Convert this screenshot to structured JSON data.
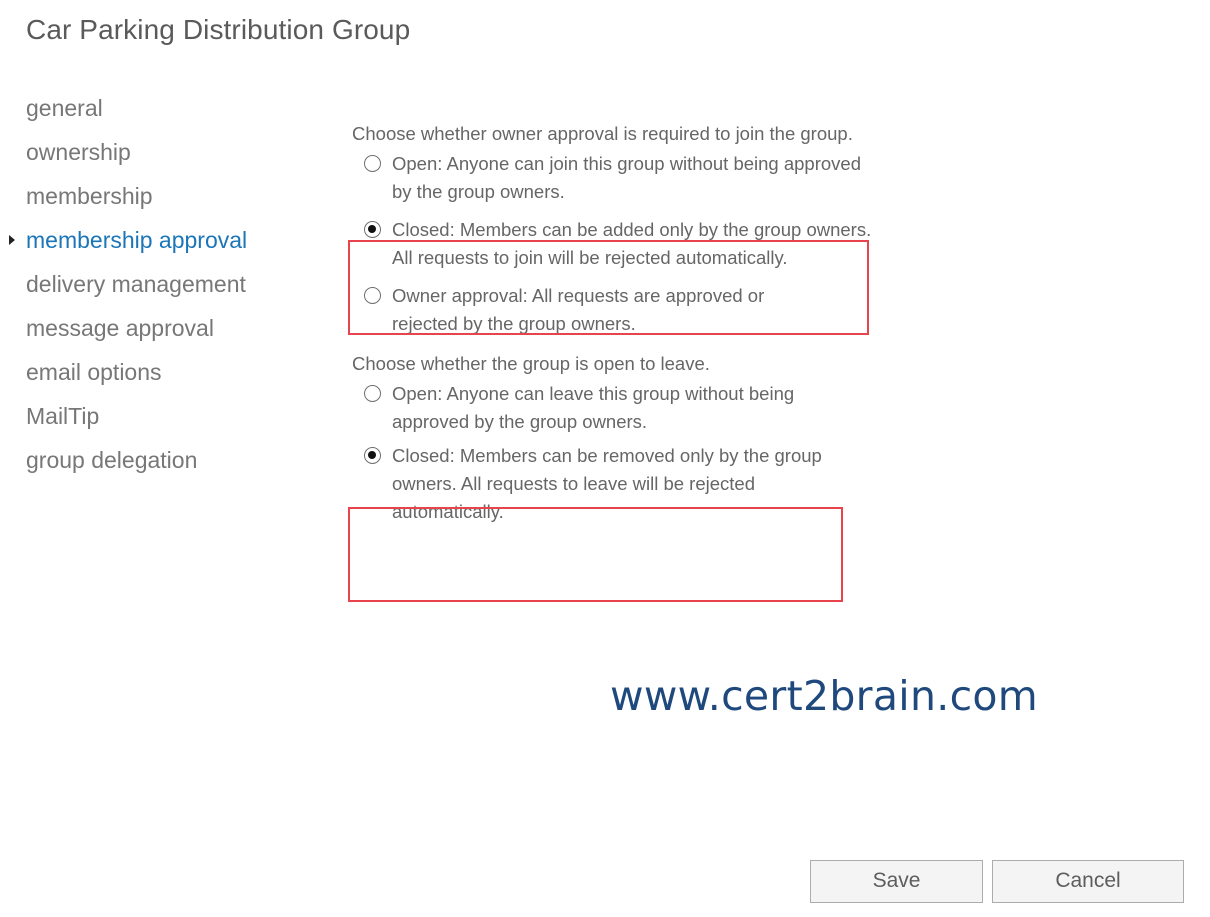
{
  "window": {
    "title": "Car Parking Distribution Group"
  },
  "sidebar": {
    "items": [
      {
        "label": "general",
        "active": false
      },
      {
        "label": "ownership",
        "active": false
      },
      {
        "label": "membership",
        "active": false
      },
      {
        "label": "membership approval",
        "active": true
      },
      {
        "label": "delivery management",
        "active": false
      },
      {
        "label": "message approval",
        "active": false
      },
      {
        "label": "email options",
        "active": false
      },
      {
        "label": "MailTip",
        "active": false
      },
      {
        "label": "group delegation",
        "active": false
      }
    ],
    "active_color": "#1b76b8"
  },
  "join": {
    "prompt": "Choose whether owner approval is required to join the group.",
    "options": [
      {
        "label": "Open: Anyone can join this group without being approved by the group owners.",
        "checked": false
      },
      {
        "label": "Closed: Members can be added only by the group owners. All requests to join will be rejected automatically.",
        "checked": true
      },
      {
        "label": "Owner approval: All requests are approved or rejected by the group owners.",
        "checked": false
      }
    ]
  },
  "leave": {
    "prompt": "Choose whether the group is open to leave.",
    "options": [
      {
        "label": "Open: Anyone can leave this group without being approved by the group owners.",
        "checked": false
      },
      {
        "label": "Closed: Members can be removed only by the group owners. All requests to leave will be rejected automatically.",
        "checked": true
      }
    ]
  },
  "highlight_color": "#e8444d",
  "watermark": {
    "text": "www.cert2brain.com",
    "color": "#1f497d"
  },
  "footer": {
    "save_label": "Save",
    "cancel_label": "Cancel"
  }
}
